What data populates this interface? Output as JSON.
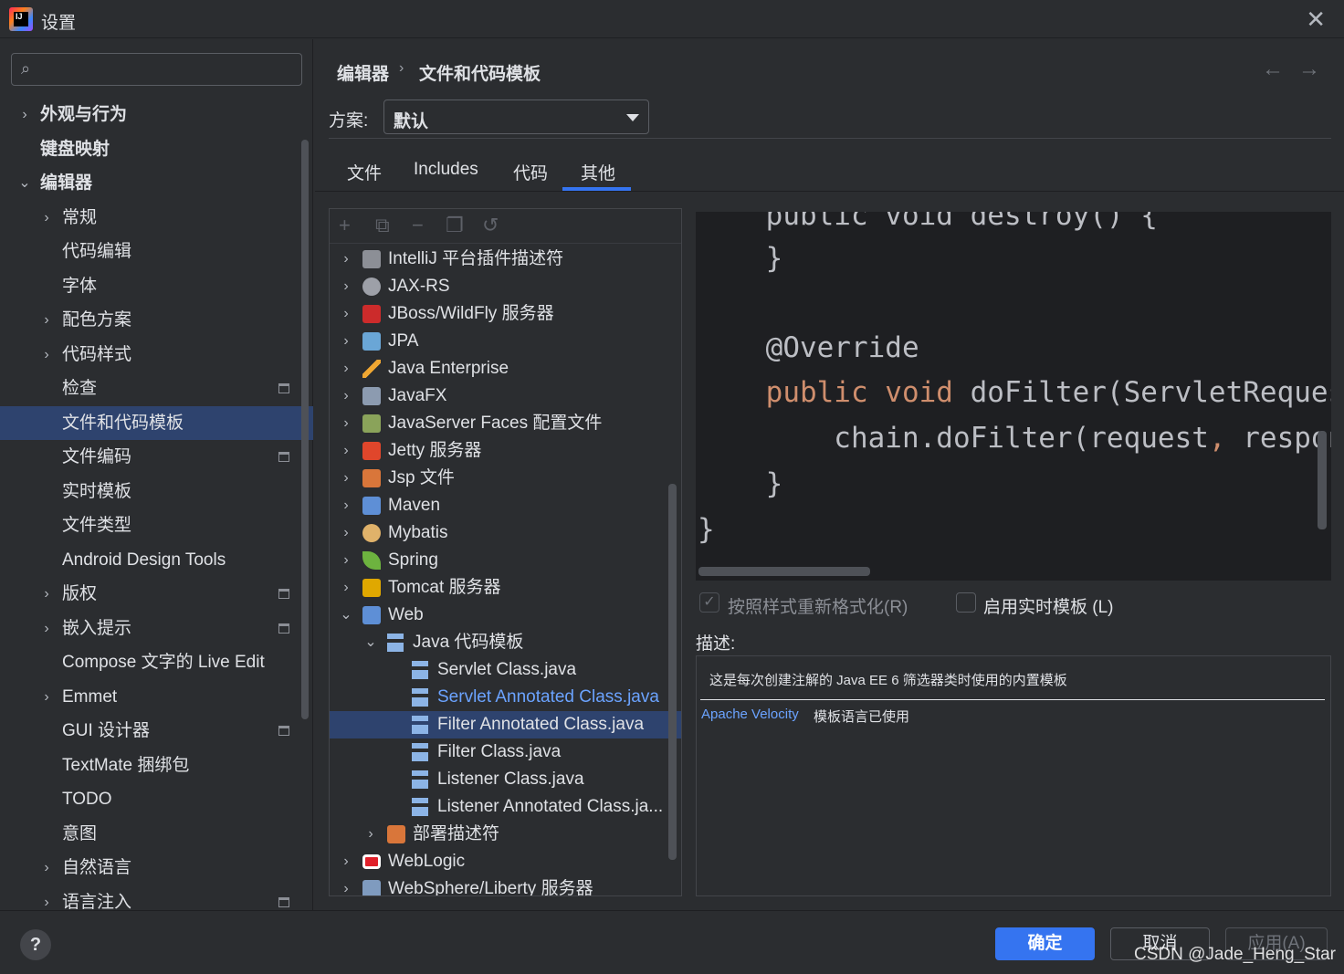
{
  "window": {
    "title": "设置",
    "close_glyph": "✕",
    "logo_text": "IJ"
  },
  "search": {
    "placeholder": "",
    "icon": "search-icon"
  },
  "sidebar": {
    "items": [
      {
        "label": "外观与行为",
        "bold": true,
        "chevron": "›"
      },
      {
        "label": "键盘映射",
        "bold": true,
        "chevron": ""
      },
      {
        "label": "编辑器",
        "bold": true,
        "chevron": "⌄"
      },
      {
        "label": "常规",
        "chevron": "›"
      },
      {
        "label": "代码编辑",
        "chevron": ""
      },
      {
        "label": "字体",
        "chevron": ""
      },
      {
        "label": "配色方案",
        "chevron": "›"
      },
      {
        "label": "代码样式",
        "chevron": "›"
      },
      {
        "label": "检查",
        "chevron": ""
      },
      {
        "label": "文件和代码模板",
        "chevron": "",
        "selected": true
      },
      {
        "label": "文件编码",
        "chevron": ""
      },
      {
        "label": "实时模板",
        "chevron": ""
      },
      {
        "label": "文件类型",
        "chevron": ""
      },
      {
        "label": "Android Design Tools",
        "chevron": ""
      },
      {
        "label": "版权",
        "chevron": "›"
      },
      {
        "label": "嵌入提示",
        "chevron": "›"
      },
      {
        "label": "Compose 文字的 Live Edit",
        "chevron": ""
      },
      {
        "label": "Emmet",
        "chevron": "›"
      },
      {
        "label": "GUI 设计器",
        "chevron": ""
      },
      {
        "label": "TextMate 捆绑包",
        "chevron": ""
      },
      {
        "label": "TODO",
        "chevron": ""
      },
      {
        "label": "意图",
        "chevron": ""
      },
      {
        "label": "自然语言",
        "chevron": "›"
      },
      {
        "label": "语言注入",
        "chevron": "›"
      }
    ]
  },
  "breadcrumb": {
    "parent": "编辑器",
    "separator": "›",
    "current": "文件和代码模板",
    "back": "←",
    "forward": "→"
  },
  "scheme": {
    "label": "方案:",
    "value": "默认"
  },
  "tabs": [
    {
      "label": "文件"
    },
    {
      "label": "Includes"
    },
    {
      "label": "代码"
    },
    {
      "label": "其他",
      "active": true
    }
  ],
  "toolbar": {
    "add": "+",
    "copy": "⧉",
    "remove": "−",
    "duplicate": "❐",
    "reset": "↺"
  },
  "template_tree": [
    {
      "label": "IntelliJ 平台插件描述符",
      "chevron": "›",
      "icon": "plugin-icon"
    },
    {
      "label": "JAX-RS",
      "chevron": "›",
      "icon": "globe-icon"
    },
    {
      "label": "JBoss/WildFly 服务器",
      "chevron": "›",
      "icon": "jboss-icon"
    },
    {
      "label": "JPA",
      "chevron": "›",
      "icon": "jpa-icon"
    },
    {
      "label": "Java Enterprise",
      "chevron": "›",
      "icon": "java-enterprise-icon"
    },
    {
      "label": "JavaFX",
      "chevron": "›",
      "icon": "javafx-folder-icon"
    },
    {
      "label": "JavaServer Faces 配置文件",
      "chevron": "›",
      "icon": "jsf-icon"
    },
    {
      "label": "Jetty 服务器",
      "chevron": "›",
      "icon": "jetty-icon"
    },
    {
      "label": "Jsp 文件",
      "chevron": "›",
      "icon": "jsp-icon"
    },
    {
      "label": "Maven",
      "chevron": "›",
      "icon": "maven-icon"
    },
    {
      "label": "Mybatis",
      "chevron": "›",
      "icon": "mybatis-icon"
    },
    {
      "label": "Spring",
      "chevron": "›",
      "icon": "spring-leaf-icon"
    },
    {
      "label": "Tomcat 服务器",
      "chevron": "›",
      "icon": "tomcat-icon"
    },
    {
      "label": "Web",
      "chevron": "⌄",
      "icon": "web-icon"
    },
    {
      "label": "Java 代码模板",
      "chevron": "⌄",
      "icon": "java-template-icon",
      "level": 1
    },
    {
      "label": "Servlet Class.java",
      "chevron": "",
      "icon": "java-template-icon",
      "level": 2
    },
    {
      "label": "Servlet Annotated Class.java",
      "chevron": "",
      "icon": "java-template-icon",
      "level": 2,
      "link": true
    },
    {
      "label": "Filter Annotated Class.java",
      "chevron": "",
      "icon": "java-template-icon",
      "level": 2,
      "selected": true
    },
    {
      "label": "Filter Class.java",
      "chevron": "",
      "icon": "java-template-icon",
      "level": 2
    },
    {
      "label": "Listener Class.java",
      "chevron": "",
      "icon": "java-template-icon",
      "level": 2
    },
    {
      "label": "Listener Annotated Class.ja...",
      "chevron": "",
      "icon": "java-template-icon",
      "level": 2
    },
    {
      "label": "部署描述符",
      "chevron": "›",
      "icon": "deployment-descriptor-icon",
      "level": 1
    },
    {
      "label": "WebLogic",
      "chevron": "›",
      "icon": "weblogic-icon"
    },
    {
      "label": "WebSphere/Liberty 服务器",
      "chevron": "›",
      "icon": "websphere-icon"
    }
  ],
  "code": {
    "lines": [
      [
        {
          "t": "    public void destroy() {",
          "kw": false
        }
      ],
      [
        {
          "t": "    }",
          "kw": false
        }
      ],
      [
        {
          "t": "",
          "kw": false
        }
      ],
      [
        {
          "t": "    @Override",
          "kw": false
        }
      ],
      [
        {
          "t": "    ",
          "kw": false
        },
        {
          "t": "public void ",
          "kw": true
        },
        {
          "t": "doFilter(ServletRequest",
          "kw": false
        }
      ],
      [
        {
          "t": "        chain.doFilter(request",
          "kw": false
        },
        {
          "t": ", ",
          "kw": true
        },
        {
          "t": "respons",
          "kw": false
        }
      ],
      [
        {
          "t": "    }",
          "kw": false
        }
      ],
      [
        {
          "t": "}",
          "kw": false
        }
      ]
    ]
  },
  "options": {
    "reformat": {
      "label": "按照样式重新格式化(R)",
      "checked": true
    },
    "live_templates": {
      "label": "启用实时模板 (L)",
      "checked": false
    }
  },
  "description": {
    "label": "描述:",
    "text": "这是每次创建注解的 Java EE 6 筛选器类时使用的内置模板",
    "link": "Apache Velocity",
    "link_suffix": "模板语言已使用"
  },
  "footer": {
    "help": "?",
    "ok": "确定",
    "cancel": "取消",
    "apply": "应用(A)"
  },
  "watermark": "CSDN @Jade_Heng_Star",
  "colors": {
    "accent": "#3574f0",
    "selection": "#2e436e",
    "keyword": "#cf8e6d",
    "link": "#6ba3ff",
    "background": "#2b2d30",
    "editor": "#1e1f22"
  }
}
